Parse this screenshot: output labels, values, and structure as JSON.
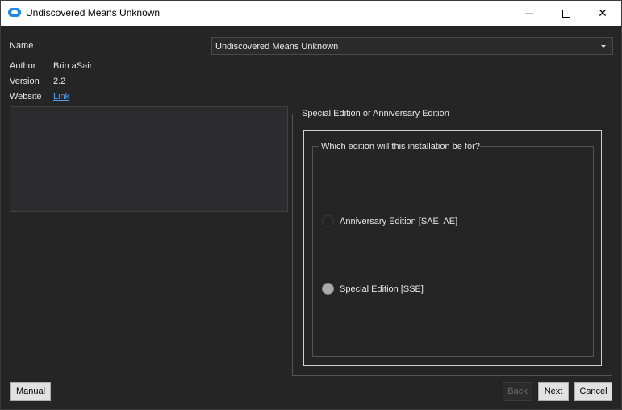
{
  "window": {
    "title": "Undiscovered Means Unknown",
    "icon": "app-cloud-icon",
    "controls": {
      "minimize": "minimize-icon",
      "maximize": "maximize-icon",
      "close": "✕"
    }
  },
  "info": {
    "name_label": "Name",
    "name_value": "Undiscovered Means Unknown",
    "author_label": "Author",
    "author_value": "Brin aSair",
    "version_label": "Version",
    "version_value": "2.2",
    "website_label": "Website",
    "website_value": "Link"
  },
  "group": {
    "title": "Special Edition or Anniversary Edition",
    "question": "Which edition will this installation be for?",
    "options": [
      {
        "label": "Anniversary Edition [SAE, AE]",
        "checked": false
      },
      {
        "label": "Special Edition [SSE]",
        "checked": true
      }
    ]
  },
  "buttons": {
    "manual": "Manual",
    "back": "Back",
    "next": "Next",
    "cancel": "Cancel"
  },
  "colors": {
    "background": "#252526",
    "link": "#4da3ff",
    "button": "#e1e1e1"
  }
}
